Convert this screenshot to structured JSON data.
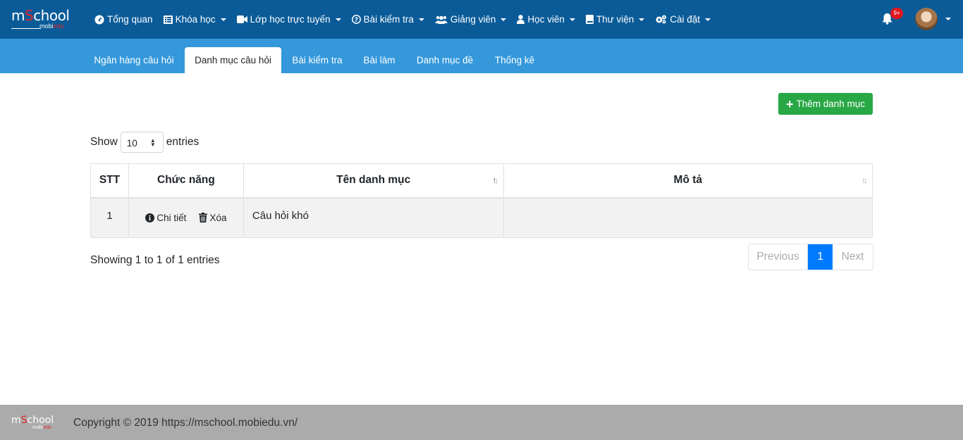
{
  "brand": {
    "logo_parts": [
      "m",
      "S",
      "chool"
    ],
    "logo_sub": [
      "mobi",
      "edu"
    ]
  },
  "nav": {
    "items": [
      {
        "label": "Tổng quan",
        "icon": "dashboard-icon",
        "dropdown": false
      },
      {
        "label": "Khóa học",
        "icon": "course-list-icon",
        "dropdown": true
      },
      {
        "label": "Lớp học trực tuyến",
        "icon": "video-camera-icon",
        "dropdown": true
      },
      {
        "label": "Bài kiểm tra",
        "icon": "question-circle-icon",
        "dropdown": true
      },
      {
        "label": "Giảng viên",
        "icon": "users-icon",
        "dropdown": true
      },
      {
        "label": "Học viên",
        "icon": "user-icon",
        "dropdown": true
      },
      {
        "label": "Thư viện",
        "icon": "book-icon",
        "dropdown": true
      },
      {
        "label": "Cài đặt",
        "icon": "cogs-icon",
        "dropdown": true
      }
    ],
    "notifications_badge": "9+"
  },
  "tabs": [
    {
      "label": "Ngân hàng câu hỏi",
      "active": false
    },
    {
      "label": "Danh mục câu hỏi",
      "active": true
    },
    {
      "label": "Bài kiểm tra",
      "active": false
    },
    {
      "label": "Bài làm",
      "active": false
    },
    {
      "label": "Danh mục đề",
      "active": false
    },
    {
      "label": "Thống kê",
      "active": false
    }
  ],
  "toolbar": {
    "add_label": "Thêm danh mục"
  },
  "length_menu": {
    "show_label": "Show",
    "value": "10",
    "entries_label": "entries"
  },
  "table": {
    "columns": [
      "STT",
      "Chức năng",
      "Tên danh mục",
      "Mô tả"
    ],
    "rows": [
      {
        "stt": "1",
        "detail_label": "Chi tiết",
        "delete_label": "Xóa",
        "name": "Câu hỏi khó",
        "description": ""
      }
    ]
  },
  "table_info": "Showing 1 to 1 of 1 entries",
  "pagination": {
    "previous": "Previous",
    "pages": [
      "1"
    ],
    "next": "Next"
  },
  "footer": {
    "copyright": "Copyright © 2019 https://mschool.mobiedu.vn/"
  },
  "colors": {
    "topbar": "#0a5b98",
    "subbar": "#3498db",
    "add_button": "#28a745",
    "active_page": "#007bff",
    "badge": "#e3171f",
    "footer": "#ababab"
  }
}
